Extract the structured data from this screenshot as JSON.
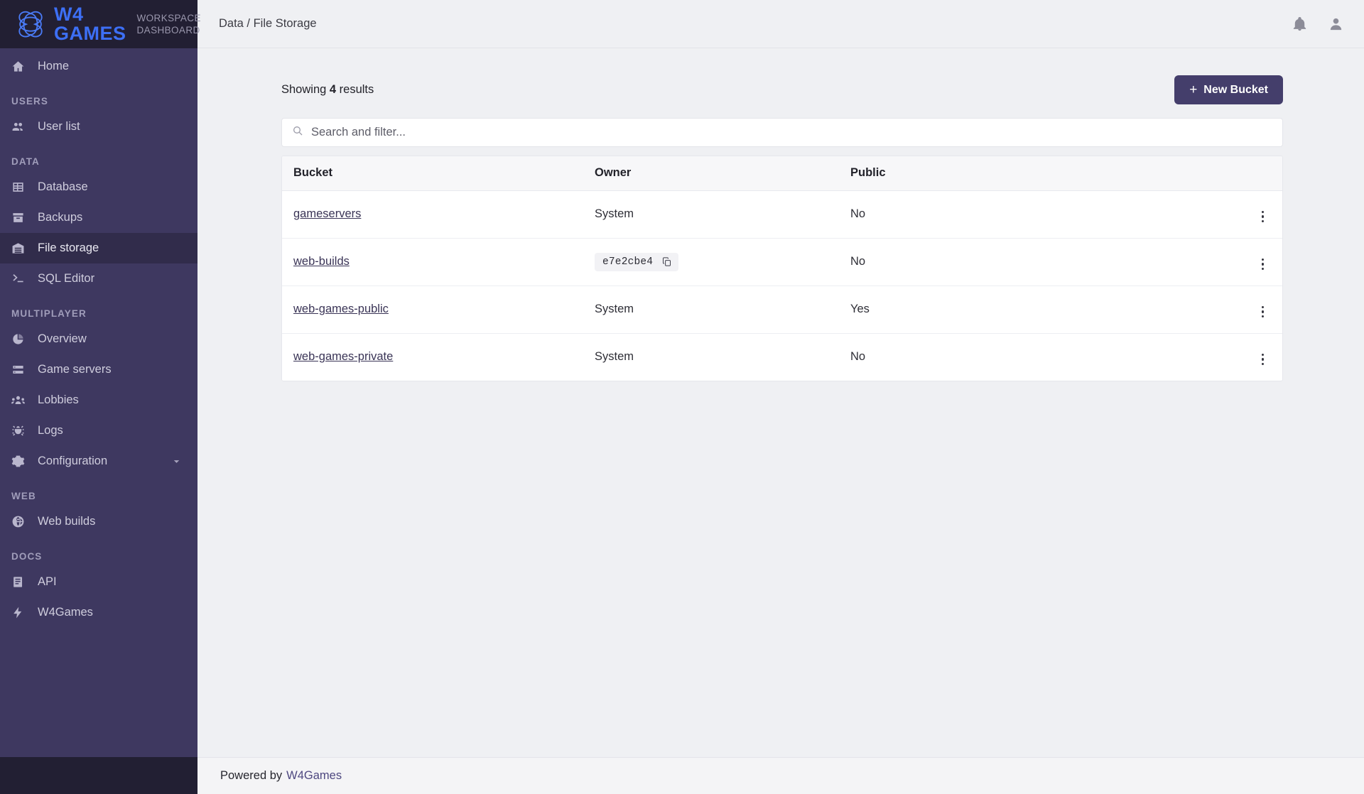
{
  "brand": {
    "logo_icon": "w4-clover-icon",
    "name_primary": "W4",
    "name_secondary": "GAMES",
    "subtitle_line1": "WORKSPACE",
    "subtitle_line2": "DASHBOARD",
    "accent_blue": "#3d6ff5",
    "accent_magenta": "#c03bd8",
    "sidebar_bg": "#3e3860",
    "sidebar_active_bg": "#312c4b"
  },
  "topbar": {
    "breadcrumb": "Data / File Storage",
    "notifications_icon": "bell-icon",
    "account_icon": "user-circle-icon"
  },
  "sidebar": {
    "home": {
      "label": "Home",
      "icon": "home-icon"
    },
    "sections": [
      {
        "label": "USERS",
        "items": [
          {
            "label": "User list",
            "icon": "users-icon",
            "active": false
          }
        ]
      },
      {
        "label": "DATA",
        "items": [
          {
            "label": "Database",
            "icon": "database-table-icon",
            "active": false
          },
          {
            "label": "Backups",
            "icon": "archive-box-icon",
            "active": false
          },
          {
            "label": "File storage",
            "icon": "warehouse-icon",
            "active": true
          },
          {
            "label": "SQL Editor",
            "icon": "terminal-icon",
            "active": false
          }
        ]
      },
      {
        "label": "MULTIPLAYER",
        "items": [
          {
            "label": "Overview",
            "icon": "pie-chart-icon",
            "active": false
          },
          {
            "label": "Game servers",
            "icon": "server-icon",
            "active": false
          },
          {
            "label": "Lobbies",
            "icon": "group-icon",
            "active": false
          },
          {
            "label": "Logs",
            "icon": "bug-icon",
            "active": false
          },
          {
            "label": "Configuration",
            "icon": "gear-icon",
            "active": false,
            "chevron": "chevron-down-icon"
          }
        ]
      },
      {
        "label": "WEB",
        "items": [
          {
            "label": "Web builds",
            "icon": "globe-icon",
            "active": false
          }
        ]
      },
      {
        "label": "DOCS",
        "items": [
          {
            "label": "API",
            "icon": "book-icon",
            "active": false
          },
          {
            "label": "W4Games",
            "icon": "bolt-icon",
            "active": false
          }
        ]
      }
    ]
  },
  "main": {
    "results_prefix": "Showing",
    "results_count": "4",
    "results_suffix": "results",
    "new_bucket_label": "New Bucket",
    "new_bucket_plus": "+",
    "search": {
      "placeholder": "Search and filter...",
      "value": "",
      "icon": "search-icon"
    },
    "table": {
      "columns": [
        "Bucket",
        "Owner",
        "Public"
      ],
      "row_menu_icon": "kebab-menu-icon",
      "rows": [
        {
          "bucket": "gameservers",
          "owner": "System",
          "owner_type": "text",
          "public": "No"
        },
        {
          "bucket": "web-builds",
          "owner": "e7e2cbe4",
          "owner_type": "code",
          "owner_copy_icon": "copy-icon",
          "public": "No"
        },
        {
          "bucket": "web-games-public",
          "owner": "System",
          "owner_type": "text",
          "public": "Yes"
        },
        {
          "bucket": "web-games-private",
          "owner": "System",
          "owner_type": "text",
          "public": "No"
        }
      ]
    }
  },
  "footer": {
    "text": "Powered by",
    "link": "W4Games"
  }
}
